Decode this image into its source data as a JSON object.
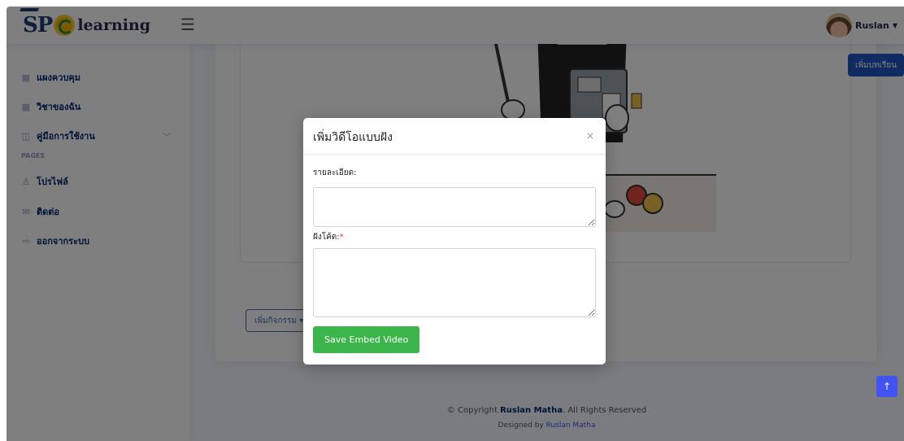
{
  "header": {
    "logo_sp": "SP",
    "logo_text": "learning",
    "user_name": "Ruslan"
  },
  "sidebar": {
    "items": [
      {
        "label": "แผงควบคุม"
      },
      {
        "label": "วิชาของฉัน"
      },
      {
        "label": "คู่มือการใช้งาน"
      },
      {
        "label": "โปรไฟล์"
      },
      {
        "label": "ติดต่อ"
      },
      {
        "label": "ออกจากระบบ"
      }
    ],
    "heading_pages": "PAGES"
  },
  "main": {
    "add_lesson_label": "เพิ่มบทเรียน",
    "add_activity_label": "เพิ่มกิจกรรม ▾"
  },
  "modal": {
    "title": "เพิ่มวิดีโอแบบฝัง",
    "close": "×",
    "detail_label": "รายละเอียด:",
    "embed_label": "ฝังโค้ด:",
    "required_mark": "*",
    "detail_value": "",
    "embed_value": "",
    "save_label": "Save Embed Video"
  },
  "footer": {
    "copyright_prefix": "© Copyright ",
    "copyright_name": "Ruslan Matha",
    "copyright_suffix": ". All Rights Reserved",
    "designed_prefix": "Designed by ",
    "designed_name": "Ruslan Matha"
  },
  "colors": {
    "brand": "#012970",
    "primary_button": "#1e56c2",
    "save_button": "#3cb54a",
    "back_to_top": "#4154f1"
  }
}
